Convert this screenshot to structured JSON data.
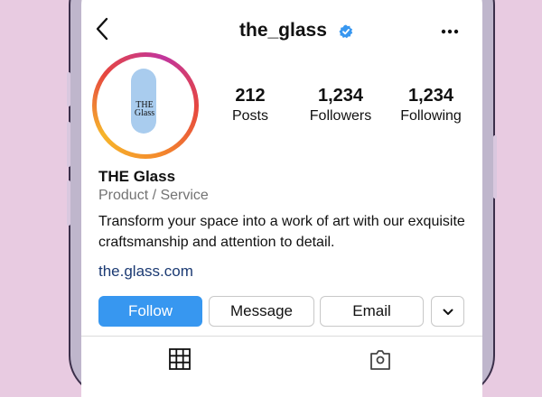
{
  "header": {
    "back_icon": "chevron-left-icon",
    "back_glyph": "‹",
    "username": "the_glass",
    "verified_icon": "verified-badge-icon",
    "more_icon": "more-horizontal-icon",
    "more_glyph": "•••"
  },
  "avatar": {
    "logo_line1": "THE",
    "logo_line2": "Glass"
  },
  "stats": [
    {
      "value": "212",
      "label": "Posts"
    },
    {
      "value": "1,234",
      "label": "Followers"
    },
    {
      "value": "1,234",
      "label": "Following"
    }
  ],
  "profile": {
    "name": "THE Glass",
    "category": "Product / Service",
    "bio": "Transform your space into a work of art with our exquisite craftsmanship and attention to detail.",
    "link": "the.glass.com"
  },
  "actions": {
    "follow": "Follow",
    "message": "Message",
    "email": "Email",
    "dropdown_glyph": "⌄"
  },
  "tabs": {
    "grid_icon": "grid-icon",
    "tagged_icon": "tagged-icon"
  },
  "colors": {
    "background": "#e8cbe1",
    "follow_button": "#3797f0",
    "link": "#1b3a73",
    "verified": "#3897f0"
  }
}
